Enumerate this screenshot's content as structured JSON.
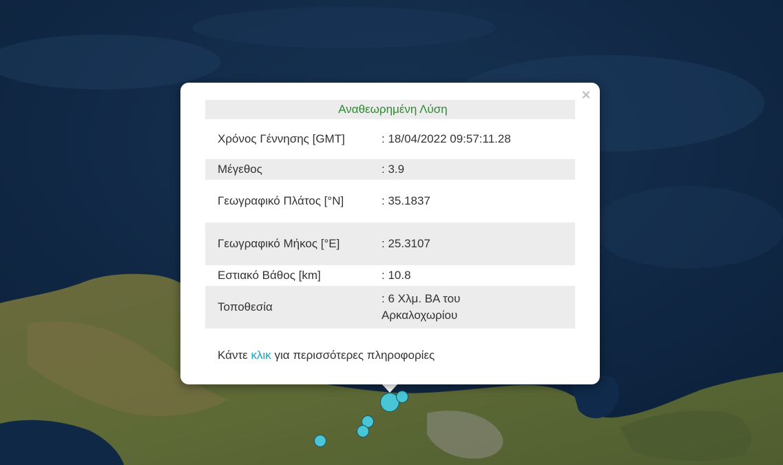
{
  "popup": {
    "header": "Αναθεωρημένη Λύση",
    "close_symbol": "×",
    "rows": [
      {
        "label": "Χρόνος Γέννησης [GMT]",
        "value": ": 18/04/2022 09:57:11.28"
      },
      {
        "label": "Μέγεθος",
        "value": ": 3.9"
      },
      {
        "label": "Γεωγραφικό Πλάτος [°N]",
        "value": ": 35.1837"
      },
      {
        "label": "Γεωγραφικό Μήκος [°E]",
        "value": ": 25.3107"
      },
      {
        "label": "Εστιακό Βάθος [km]",
        "value": ": 10.8"
      },
      {
        "label": "Τοποθεσία",
        "value": ": 6 Χλμ. ΒΑ του Αρκαλοχωρίου"
      }
    ],
    "more_prefix": "Κάντε ",
    "more_link": "κλικ",
    "more_suffix": " για περισσότερες πληροφορίες"
  },
  "colors": {
    "sea": "#0d2440",
    "marker": "#49c6d6",
    "header_text": "#2f8a2f",
    "link": "#1aa0b9"
  },
  "icons": {
    "close": "close-icon"
  }
}
